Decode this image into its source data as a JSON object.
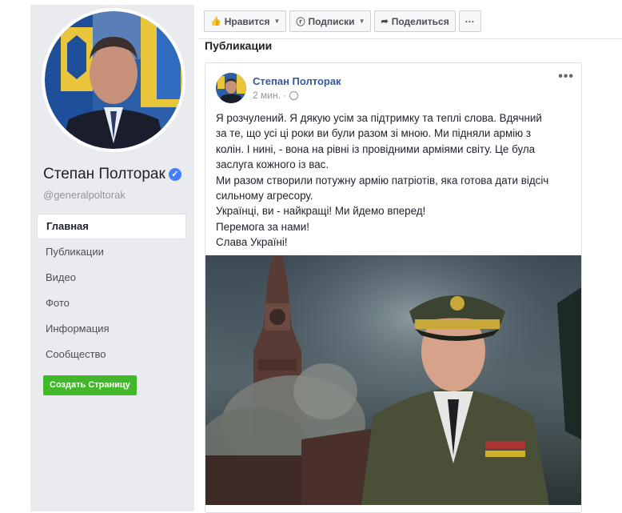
{
  "profile": {
    "name": "Степан Полторак",
    "handle": "@generalpoltorak",
    "verified_icon": "verified-check-icon"
  },
  "nav": {
    "items": [
      {
        "label": "Главная",
        "active": true
      },
      {
        "label": "Публикации"
      },
      {
        "label": "Видео"
      },
      {
        "label": "Фото"
      },
      {
        "label": "Информация"
      },
      {
        "label": "Сообщество"
      }
    ],
    "create_page": "Создать Страницу"
  },
  "toolbar": {
    "like": "Нравится",
    "follow": "Подписки",
    "share": "Поделиться",
    "more": "···"
  },
  "section_title": "Публикации",
  "post": {
    "author": "Степан Полторак",
    "time": "2 мин. ·",
    "more": "•••",
    "lines": [
      "Я розчулений. Я дякую усім за підтримку та теплі слова. Вдячний",
      "за те, що усі ці роки ви були разом зі мною. Ми підняли армію з",
      "колін. І нині, - вона на рівні із провідними арміями світу. Це була",
      "заслуга кожного із вас.",
      "Ми разом створили потужну армію патріотів, яка готова дати відсіч",
      "сильному агресору.",
      "Українці, ви - найкращі! Ми йдемо вперед!",
      "Перемога за нами!",
      "Слава Україні!"
    ]
  },
  "colors": {
    "link": "#365899",
    "create_button": "#42b72a",
    "sidebar_bg": "#e9ebee"
  }
}
